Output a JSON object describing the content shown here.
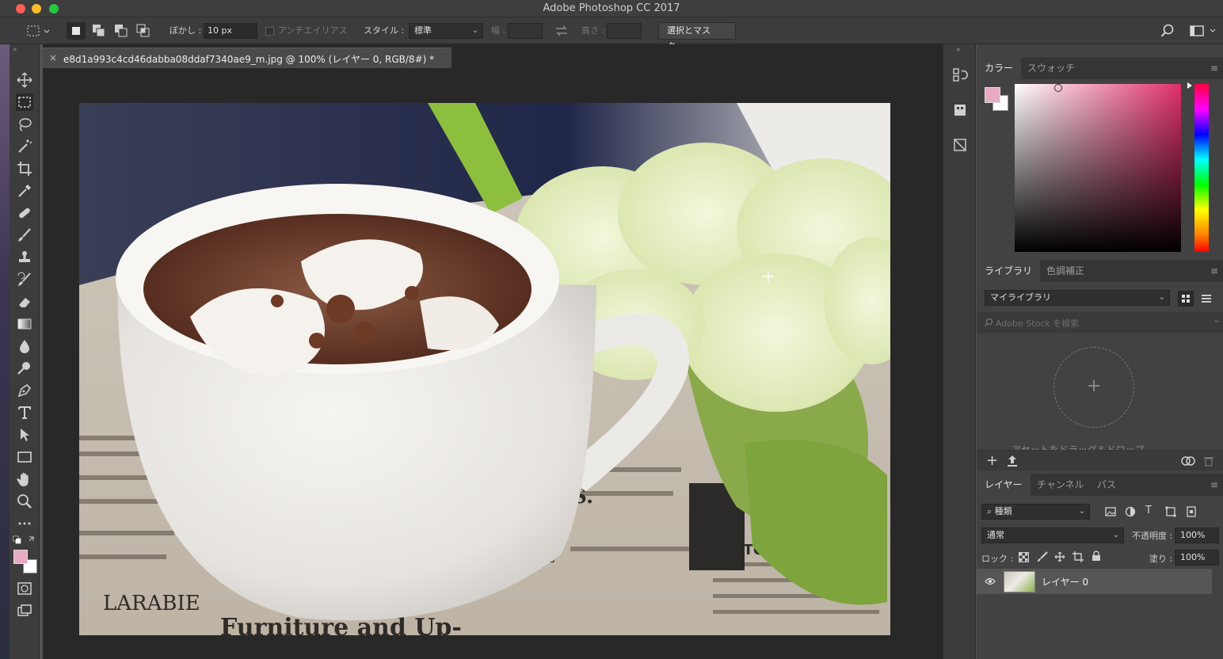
{
  "window": {
    "title": "Adobe Photoshop CC 2017"
  },
  "options": {
    "feather_label": "ぼかし :",
    "feather_value": "10 px",
    "antialias_label": "アンチエイリアス",
    "style_label": "スタイル :",
    "style_value": "標準",
    "width_label": "幅 :",
    "height_label": "高さ :",
    "select_mask_button": "選択とマスク..."
  },
  "document": {
    "tab_close": "×",
    "tab_title": "e8d1a993c4cd46dabba08ddaf7340ae9_m.jpg @ 100% (レイヤー 0, RGB/8#) *"
  },
  "panels": {
    "color": {
      "tabs": [
        "カラー",
        "スウォッチ"
      ],
      "foreground": "#e8a9c3",
      "background": "#ffffff"
    },
    "library": {
      "tabs": [
        "ライブラリ",
        "色調補正"
      ],
      "selected_library": "マイライブラリ",
      "search_placeholder": "Adobe Stock を検索",
      "drop_text": "アセットをドラッグ＆ドロップ"
    },
    "layers": {
      "tabs": [
        "レイヤー",
        "チャンネル",
        "パス"
      ],
      "filter_kind": "種類",
      "blend_mode": "通常",
      "opacity_label": "不透明度 :",
      "opacity_value": "100%",
      "lock_label": "ロック :",
      "fill_label": "塗り :",
      "fill_value": "100%",
      "items": [
        {
          "name": "レイヤー 0"
        }
      ]
    }
  },
  "tools": [
    "move-icon",
    "marquee-icon",
    "lasso-icon",
    "magic-wand-icon",
    "crop-icon",
    "eyedropper-icon",
    "healing-brush-icon",
    "brush-icon",
    "stamp-icon",
    "history-brush-icon",
    "eraser-icon",
    "gradient-icon",
    "blur-icon",
    "dodge-icon",
    "pen-icon",
    "type-icon",
    "path-selection-icon",
    "rectangle-icon",
    "hand-icon",
    "zoom-icon",
    "more-tools-icon"
  ]
}
